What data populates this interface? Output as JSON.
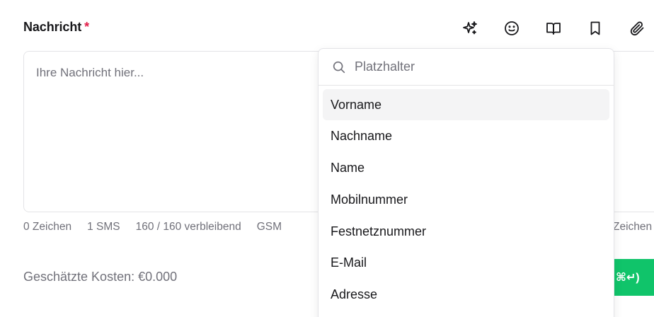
{
  "field": {
    "label": "Nachricht",
    "required_mark": "*"
  },
  "toolbar": {
    "icons": [
      "sparkles-icon",
      "smiley-icon",
      "book-icon",
      "bookmark-icon",
      "paperclip-icon"
    ]
  },
  "message": {
    "placeholder": "Ihre Nachricht hier...",
    "value": ""
  },
  "meta": {
    "chars": "0 Zeichen",
    "sms": "1 SMS",
    "remaining": "160 / 160 verbleibend",
    "encoding": "GSM",
    "right": "Zeichen"
  },
  "cost": {
    "label": "Geschätzte Kosten: €0.000"
  },
  "send": {
    "label": "⌘↵)"
  },
  "placeholder_menu": {
    "search_placeholder": "Platzhalter",
    "items": [
      "Vorname",
      "Nachname",
      "Name",
      "Mobilnummer",
      "Festnetznummer",
      "E-Mail",
      "Adresse"
    ],
    "active_index": 0
  }
}
